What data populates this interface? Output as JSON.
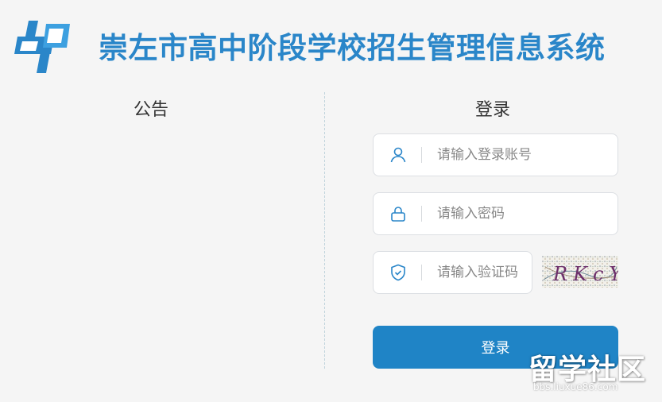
{
  "header": {
    "title": "崇左市高中阶段学校招生管理信息系统"
  },
  "notice": {
    "title": "公告"
  },
  "login": {
    "title": "登录",
    "username_placeholder": "请输入登录账号",
    "password_placeholder": "请输入密码",
    "captcha_placeholder": "请输入验证码",
    "captcha_text": "RKcY",
    "submit_label": "登录"
  },
  "watermark": {
    "big": "留学社区",
    "small": "bbs.liuxue86.com"
  },
  "colors": {
    "accent": "#2a86c9",
    "button": "#1f84c6",
    "background": "#f5f5f5"
  },
  "icons": {
    "username": "user-icon",
    "password": "lock-icon",
    "captcha": "shield-check-icon"
  }
}
